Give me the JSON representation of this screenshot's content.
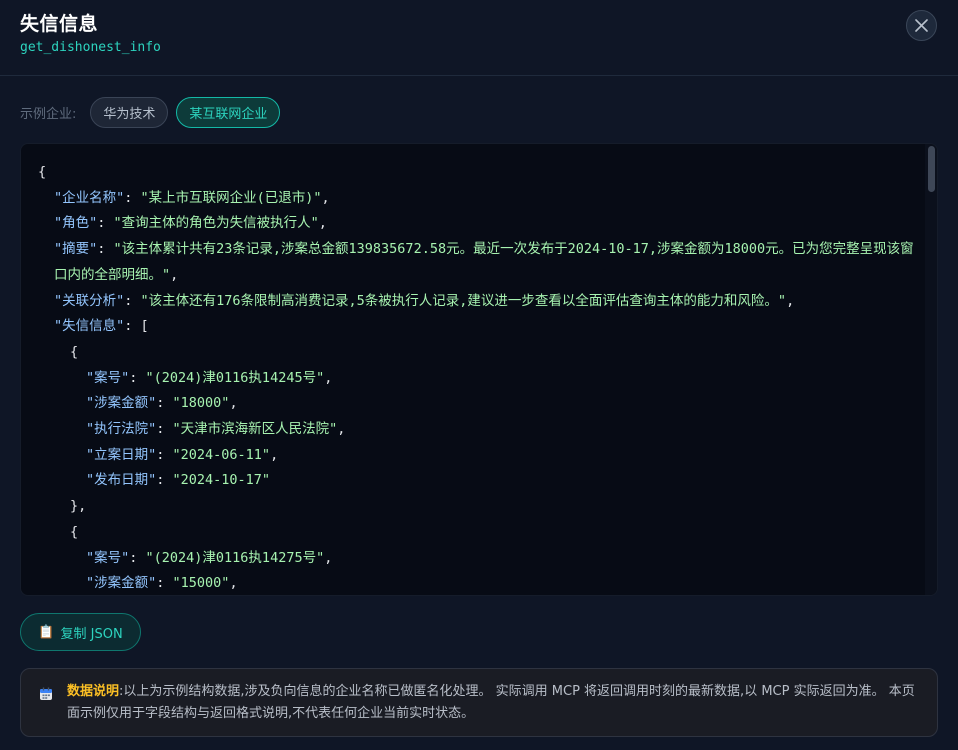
{
  "header": {
    "title": "失信信息",
    "subtitle": "get_dishonest_info",
    "close_icon": "close-icon"
  },
  "examples": {
    "label": "示例企业:",
    "chips": [
      {
        "label": "华为技术",
        "active": false
      },
      {
        "label": "某互联网企业",
        "active": true
      }
    ]
  },
  "json_view": {
    "lines": [
      {
        "indent": 0,
        "parts": [
          {
            "t": "p",
            "v": "{"
          }
        ]
      },
      {
        "indent": 1,
        "parts": [
          {
            "t": "k",
            "v": "\"企业名称\""
          },
          {
            "t": "p",
            "v": ": "
          },
          {
            "t": "s",
            "v": "\"某上市互联网企业(已退市)\""
          },
          {
            "t": "p",
            "v": ","
          }
        ]
      },
      {
        "indent": 1,
        "parts": [
          {
            "t": "k",
            "v": "\"角色\""
          },
          {
            "t": "p",
            "v": ": "
          },
          {
            "t": "s",
            "v": "\"查询主体的角色为失信被执行人\""
          },
          {
            "t": "p",
            "v": ","
          }
        ]
      },
      {
        "indent": 1,
        "parts": [
          {
            "t": "k",
            "v": "\"摘要\""
          },
          {
            "t": "p",
            "v": ": "
          },
          {
            "t": "s",
            "v": "\"该主体累计共有23条记录,涉案总金额139835672.58元。最近一次发布于2024-10-17,涉案金额为18000元。已为您完整呈现该窗口内的全部明细。\""
          },
          {
            "t": "p",
            "v": ","
          }
        ]
      },
      {
        "indent": 1,
        "parts": [
          {
            "t": "k",
            "v": "\"关联分析\""
          },
          {
            "t": "p",
            "v": ": "
          },
          {
            "t": "s",
            "v": "\"该主体还有176条限制高消费记录,5条被执行人记录,建议进一步查看以全面评估查询主体的能力和风险。\""
          },
          {
            "t": "p",
            "v": ","
          }
        ]
      },
      {
        "indent": 1,
        "parts": [
          {
            "t": "k",
            "v": "\"失信信息\""
          },
          {
            "t": "p",
            "v": ": ["
          }
        ]
      },
      {
        "indent": 2,
        "parts": [
          {
            "t": "p",
            "v": "{"
          }
        ]
      },
      {
        "indent": 3,
        "parts": [
          {
            "t": "k",
            "v": "\"案号\""
          },
          {
            "t": "p",
            "v": ": "
          },
          {
            "t": "s",
            "v": "\"(2024)津0116执14245号\""
          },
          {
            "t": "p",
            "v": ","
          }
        ]
      },
      {
        "indent": 3,
        "parts": [
          {
            "t": "k",
            "v": "\"涉案金额\""
          },
          {
            "t": "p",
            "v": ": "
          },
          {
            "t": "s",
            "v": "\"18000\""
          },
          {
            "t": "p",
            "v": ","
          }
        ]
      },
      {
        "indent": 3,
        "parts": [
          {
            "t": "k",
            "v": "\"执行法院\""
          },
          {
            "t": "p",
            "v": ": "
          },
          {
            "t": "s",
            "v": "\"天津市滨海新区人民法院\""
          },
          {
            "t": "p",
            "v": ","
          }
        ]
      },
      {
        "indent": 3,
        "parts": [
          {
            "t": "k",
            "v": "\"立案日期\""
          },
          {
            "t": "p",
            "v": ": "
          },
          {
            "t": "s",
            "v": "\"2024-06-11\""
          },
          {
            "t": "p",
            "v": ","
          }
        ]
      },
      {
        "indent": 3,
        "parts": [
          {
            "t": "k",
            "v": "\"发布日期\""
          },
          {
            "t": "p",
            "v": ": "
          },
          {
            "t": "s",
            "v": "\"2024-10-17\""
          }
        ]
      },
      {
        "indent": 2,
        "parts": [
          {
            "t": "p",
            "v": "},"
          }
        ]
      },
      {
        "indent": 2,
        "parts": [
          {
            "t": "p",
            "v": "{"
          }
        ]
      },
      {
        "indent": 3,
        "parts": [
          {
            "t": "k",
            "v": "\"案号\""
          },
          {
            "t": "p",
            "v": ": "
          },
          {
            "t": "s",
            "v": "\"(2024)津0116执14275号\""
          },
          {
            "t": "p",
            "v": ","
          }
        ]
      },
      {
        "indent": 3,
        "parts": [
          {
            "t": "k",
            "v": "\"涉案金额\""
          },
          {
            "t": "p",
            "v": ": "
          },
          {
            "t": "s",
            "v": "\"15000\""
          },
          {
            "t": "p",
            "v": ","
          }
        ]
      }
    ]
  },
  "copy_button": {
    "icon": "clipboard-icon",
    "label": "复制 JSON"
  },
  "notice": {
    "icon": "calendar-icon",
    "heading": "数据说明",
    "text": ":以上为示例结构数据,涉及负向信息的企业名称已做匿名化处理。 实际调用 MCP 将返回调用时刻的最新数据,以 MCP 实际返回为准。 本页面示例仅用于字段结构与返回格式说明,不代表任何企业当前实时状态。"
  },
  "colors": {
    "background": "#0f1626",
    "accent": "#2dd4bf",
    "json_key": "#93c5fd",
    "json_string": "#a7f3b0",
    "notice_heading": "#fbbf24"
  }
}
